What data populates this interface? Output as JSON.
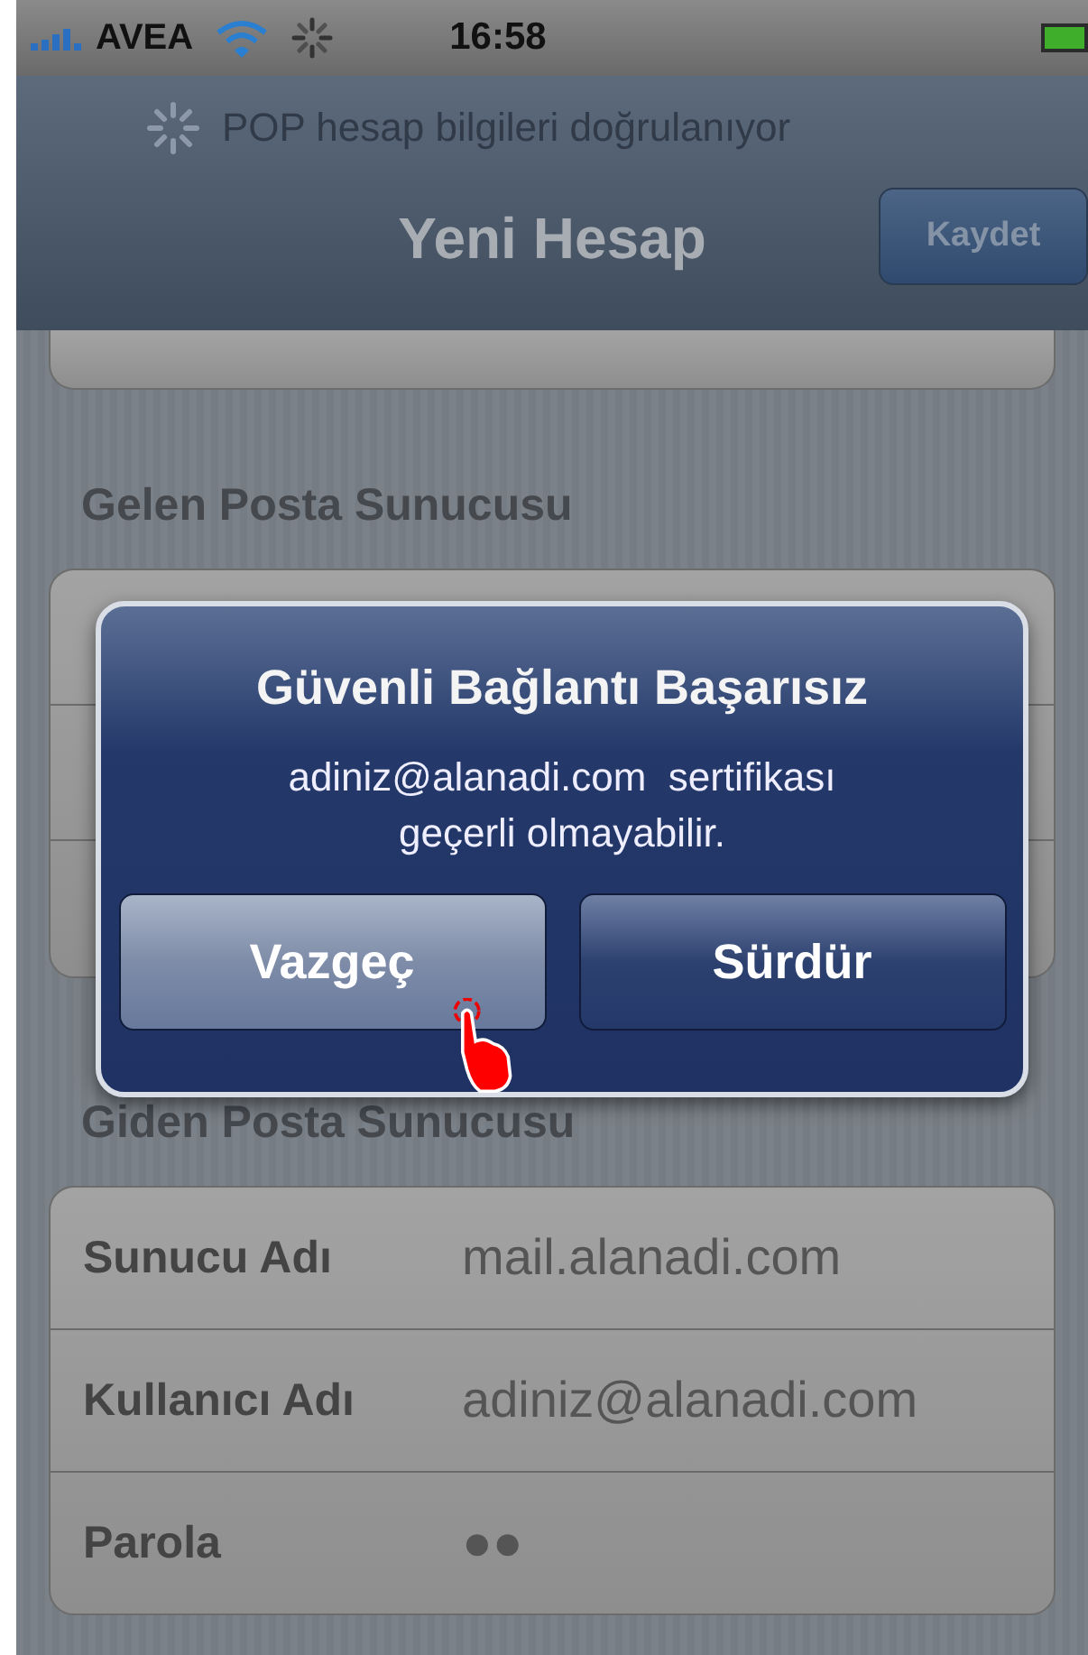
{
  "status_bar": {
    "carrier": "AVEA",
    "time": "16:58"
  },
  "nav_bar": {
    "prompt": "POP hesap bilgileri doğrulanıyor",
    "title": "Yeni Hesap",
    "save_button": {
      "label": "Kaydet",
      "disabled": true
    }
  },
  "incoming_section": {
    "header": "Gelen Posta Sunucusu"
  },
  "outgoing_section": {
    "header": "Giden Posta Sunucusu",
    "rows": [
      {
        "label": "Sunucu Adı",
        "value": "mail.alanadi.com"
      },
      {
        "label": "Kullanıcı Adı",
        "value": "adiniz@alanadi.com"
      },
      {
        "label": "Parola",
        "value": "●●"
      }
    ]
  },
  "alert": {
    "title": "Güvenli Bağlantı Başarısız",
    "message_lines": [
      "adiniz@alanadi.com  sertifikası",
      "geçerli olmayabilir."
    ],
    "buttons": [
      {
        "label": "Vazgeç",
        "selected": true
      },
      {
        "label": "Sürdür",
        "selected": false
      }
    ]
  }
}
